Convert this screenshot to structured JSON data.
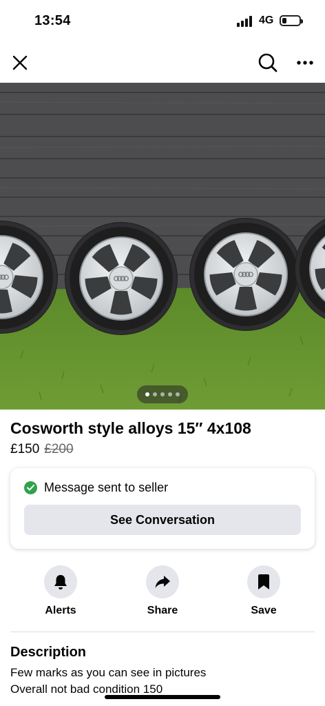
{
  "status_bar": {
    "time": "13:54",
    "network": "4G"
  },
  "nav": {
    "close_icon": "close-icon",
    "search_icon": "search-icon",
    "more_icon": "more-icon"
  },
  "carousel": {
    "total": 5,
    "current": 1
  },
  "listing": {
    "title": "Cosworth style alloys 15″ 4x108",
    "price": "£150",
    "old_price": "£200"
  },
  "message_card": {
    "status": "Message sent to seller",
    "button": "See Conversation"
  },
  "actions": [
    {
      "label": "Alerts",
      "icon": "bell-icon"
    },
    {
      "label": "Share",
      "icon": "share-icon"
    },
    {
      "label": "Save",
      "icon": "bookmark-icon"
    }
  ],
  "description": {
    "heading": "Description",
    "lines": [
      "Few marks as you can see in pictures",
      "Overall not bad condition 150"
    ]
  },
  "colors": {
    "success": "#31a24c",
    "button_bg": "#e4e6eb",
    "muted": "#65676b"
  }
}
